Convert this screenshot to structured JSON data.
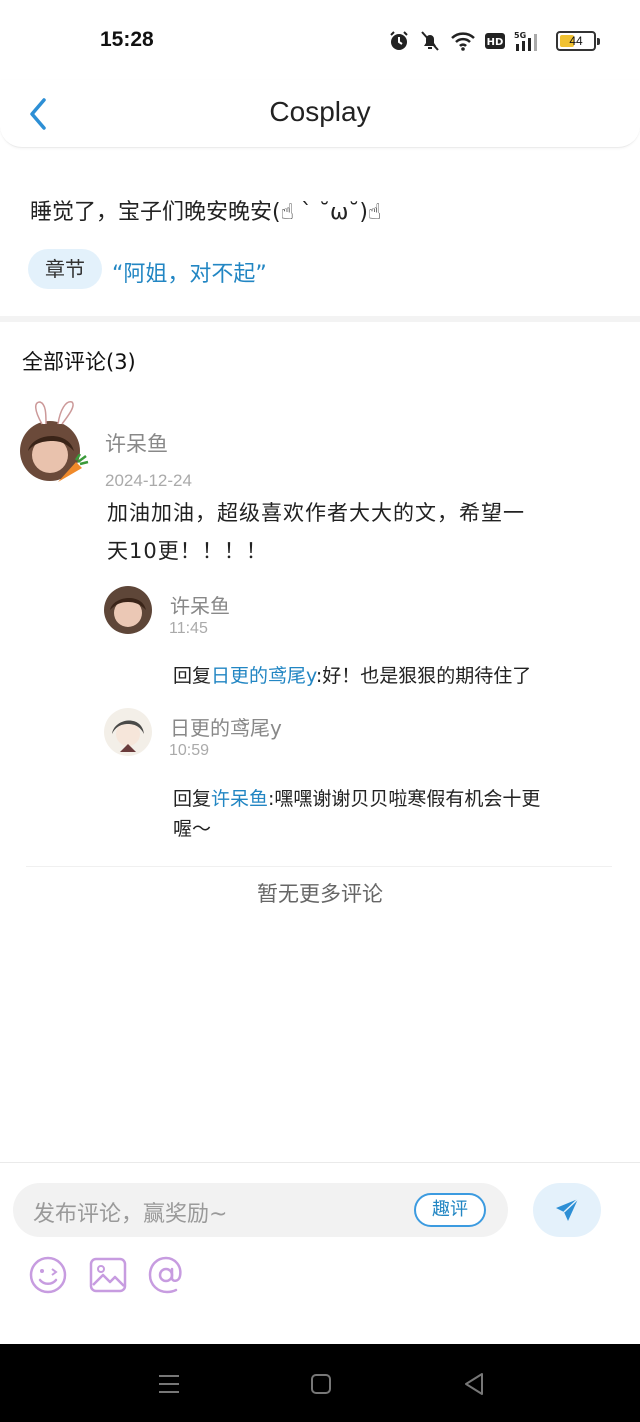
{
  "status": {
    "time": "15:28",
    "battery": "44",
    "battery_level": 0.44,
    "network_label": "5G"
  },
  "header": {
    "title": "Cosplay"
  },
  "post": {
    "text": "睡觉了，宝子们晚安晚安(☝ ˋ ˘ω˘)☝",
    "chapter_tag": "章节",
    "chapter_title": "“阿姐，对不起”"
  },
  "comments": {
    "title": "全部评论(3)",
    "main": {
      "user": "许呆鱼",
      "date": "2024-12-24",
      "body_line1": "加油加油，超级喜欢作者大大的文，希望一",
      "body_line2": "天10更！！！！"
    },
    "replies": [
      {
        "user": "许呆鱼",
        "time": "11:45",
        "prefix": "回复",
        "mention": "日更的鸢尾y",
        "text": ":好！也是狠狠的期待住了"
      },
      {
        "user": "日更的鸢尾y",
        "time": "10:59",
        "prefix": "回复",
        "mention": "许呆鱼",
        "text_line1": ":嘿嘿谢谢贝贝啦寒假有机会十更",
        "text_line2": "喔～"
      }
    ],
    "no_more": "暂无更多评论"
  },
  "input": {
    "placeholder": "发布评论，赢奖励~",
    "quping": "趣评"
  },
  "tools": [
    "smile-icon",
    "image-icon",
    "at-icon"
  ],
  "colors": {
    "accent": "#2286c3",
    "tag_bg": "#e3f1fb",
    "icon_purple": "#c79ce0"
  }
}
